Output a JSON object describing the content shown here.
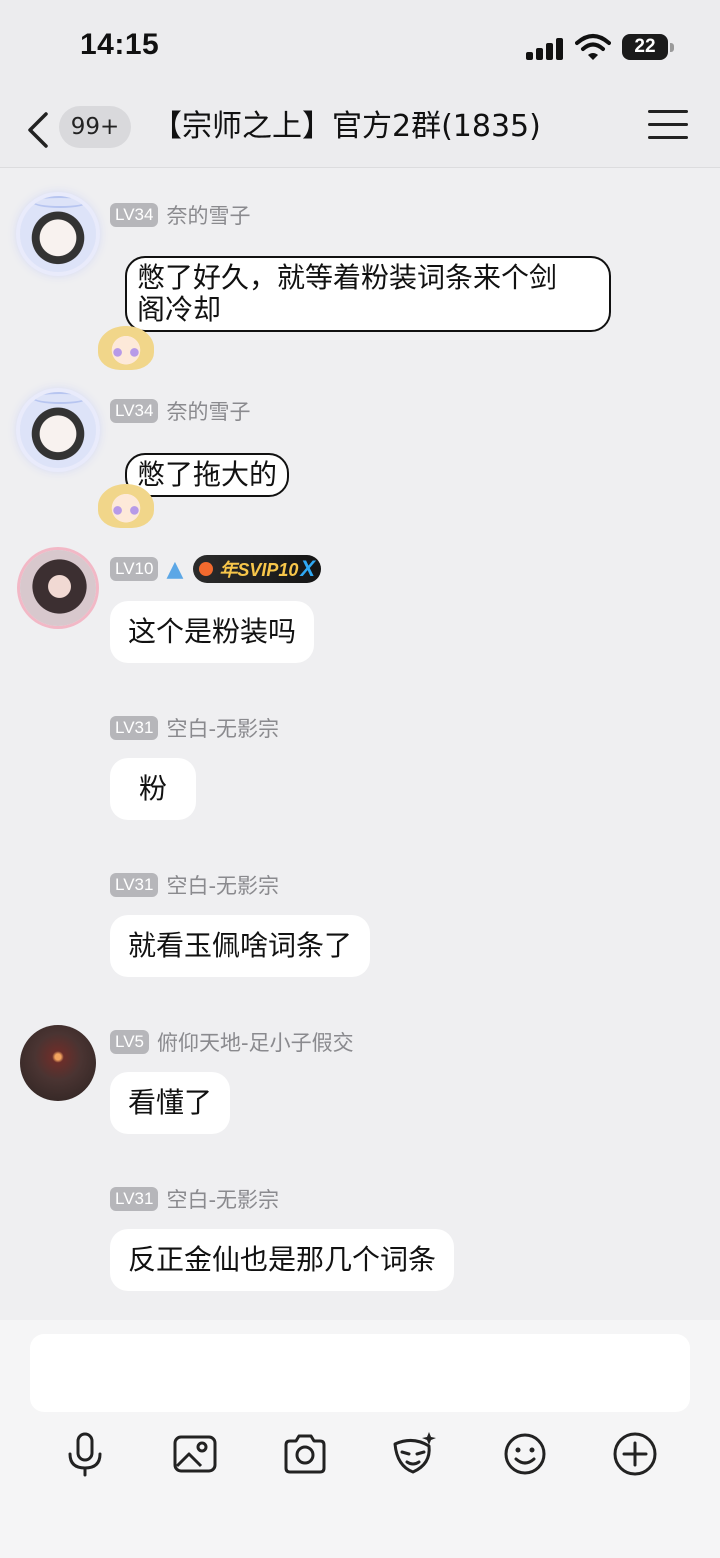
{
  "status": {
    "time": "14:15",
    "battery": "22"
  },
  "header": {
    "badge": "99+",
    "title": "【宗师之上】官方2群(1835)"
  },
  "messages": [
    {
      "level": "LV34",
      "name": "奈的雪子",
      "text_line1": "憋了好久，就等着粉装词条来个剑",
      "text_line2": "阁冷却"
    },
    {
      "level": "LV34",
      "name": "奈的雪子",
      "text": "憋了拖大的"
    },
    {
      "level": "LV10",
      "badge_icon": "whale-icon",
      "svip": "SVIP10",
      "svip_prefix": "年",
      "svip_x": "X",
      "text": "这个是粉装吗"
    },
    {
      "level": "LV31",
      "name": "空白-无影宗",
      "text": "粉"
    },
    {
      "level": "LV31",
      "name": "空白-无影宗",
      "text": "就看玉佩啥词条了"
    },
    {
      "level": "LV5",
      "name": "俯仰天地-足小子假交",
      "text": "看懂了"
    },
    {
      "level": "LV31",
      "name": "空白-无影宗",
      "text": "反正金仙也是那几个词条"
    }
  ],
  "toolbar": [
    "microphone-icon",
    "image-icon",
    "camera-icon",
    "sticker-icon",
    "emoji-icon",
    "plus-icon"
  ]
}
